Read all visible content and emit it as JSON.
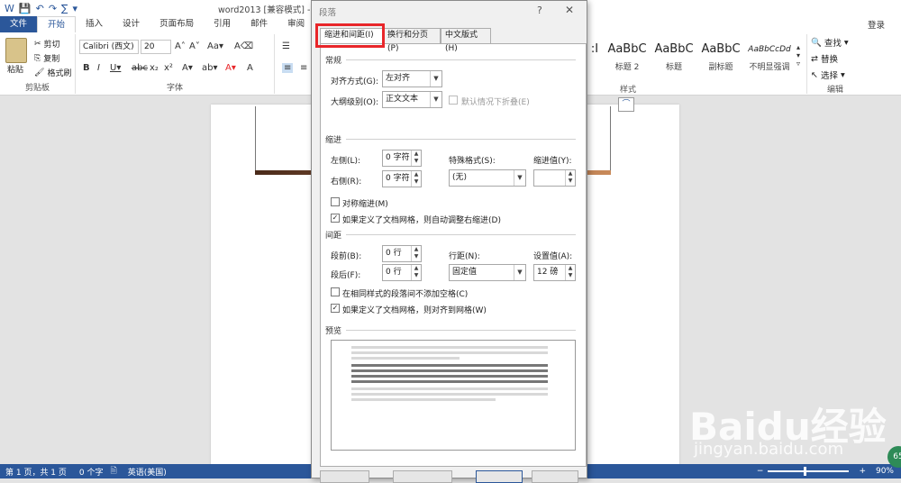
{
  "app": {
    "doc_title": "word2013 [兼容模式] - Word",
    "login": "登录",
    "win_controls": [
      "?",
      "▭",
      "—",
      "☐"
    ]
  },
  "quick_access": [
    "W",
    "💾",
    "↶",
    "↷",
    "∑",
    "▾"
  ],
  "ribbon_tabs": [
    "文件",
    "开始",
    "插入",
    "设计",
    "页面布局",
    "引用",
    "邮件",
    "审阅"
  ],
  "clipboard": {
    "paste": "粘贴",
    "cut": "剪切",
    "copy": "复制",
    "format_painter": "格式刷",
    "group_label": "剪贴板"
  },
  "font": {
    "name": "Calibri (西文)",
    "size": "20",
    "group_label": "字体"
  },
  "styles": {
    "items": [
      {
        "preview": "AaBbC",
        "name": "标题 2"
      },
      {
        "preview": "AaBbC",
        "name": "标题"
      },
      {
        "preview": "AaBbC",
        "name": "副标题"
      },
      {
        "preview": "AaBbCcDd",
        "name": "不明显强调"
      }
    ],
    "group_label": "样式"
  },
  "editing": {
    "find": "查找",
    "replace": "替换",
    "select": "选择",
    "group_label": "编辑"
  },
  "status": {
    "page": "第 1 页，共 1 页",
    "words": "0 个字",
    "lang": "英语(美国)",
    "zoom": "90%"
  },
  "dialog": {
    "title": "段落",
    "help": "?",
    "close": "✕",
    "tabs": [
      "缩进和间距(I)",
      "换行和分页(P)",
      "中文版式(H)"
    ],
    "general": {
      "section": "常规",
      "align_label": "对齐方式(G):",
      "align_value": "左对齐",
      "outline_label": "大纲级别(O):",
      "outline_value": "正文文本",
      "collapse_label": "默认情况下折叠(E)"
    },
    "indent": {
      "section": "缩进",
      "left_label": "左侧(L):",
      "left_value": "0 字符",
      "right_label": "右侧(R):",
      "right_value": "0 字符",
      "special_label": "特殊格式(S):",
      "special_value": "(无)",
      "indent_by_label": "缩进值(Y):",
      "indent_by_value": "",
      "mirror_label": "对称缩进(M)",
      "auto_adjust_label": "如果定义了文档网格，则自动调整右缩进(D)"
    },
    "spacing": {
      "section": "间距",
      "before_label": "段前(B):",
      "before_value": "0 行",
      "after_label": "段后(F):",
      "after_value": "0 行",
      "line_label": "行距(N):",
      "line_value": "固定值",
      "at_label": "设置值(A):",
      "at_value": "12 磅",
      "no_space_label": "在相同样式的段落间不添加空格(C)",
      "snap_grid_label": "如果定义了文档网格，则对齐到网格(W)"
    },
    "preview_section": "预览",
    "checkboxes": {
      "collapse": false,
      "mirror": false,
      "auto_adjust": true,
      "no_space": false,
      "snap_grid": true
    }
  },
  "watermark": {
    "brand": "Baidu经验",
    "url": "jingyan.baidu.com",
    "badge": "65"
  },
  "colors": {
    "accent": "#2b579a",
    "highlight": "#e8262a"
  }
}
